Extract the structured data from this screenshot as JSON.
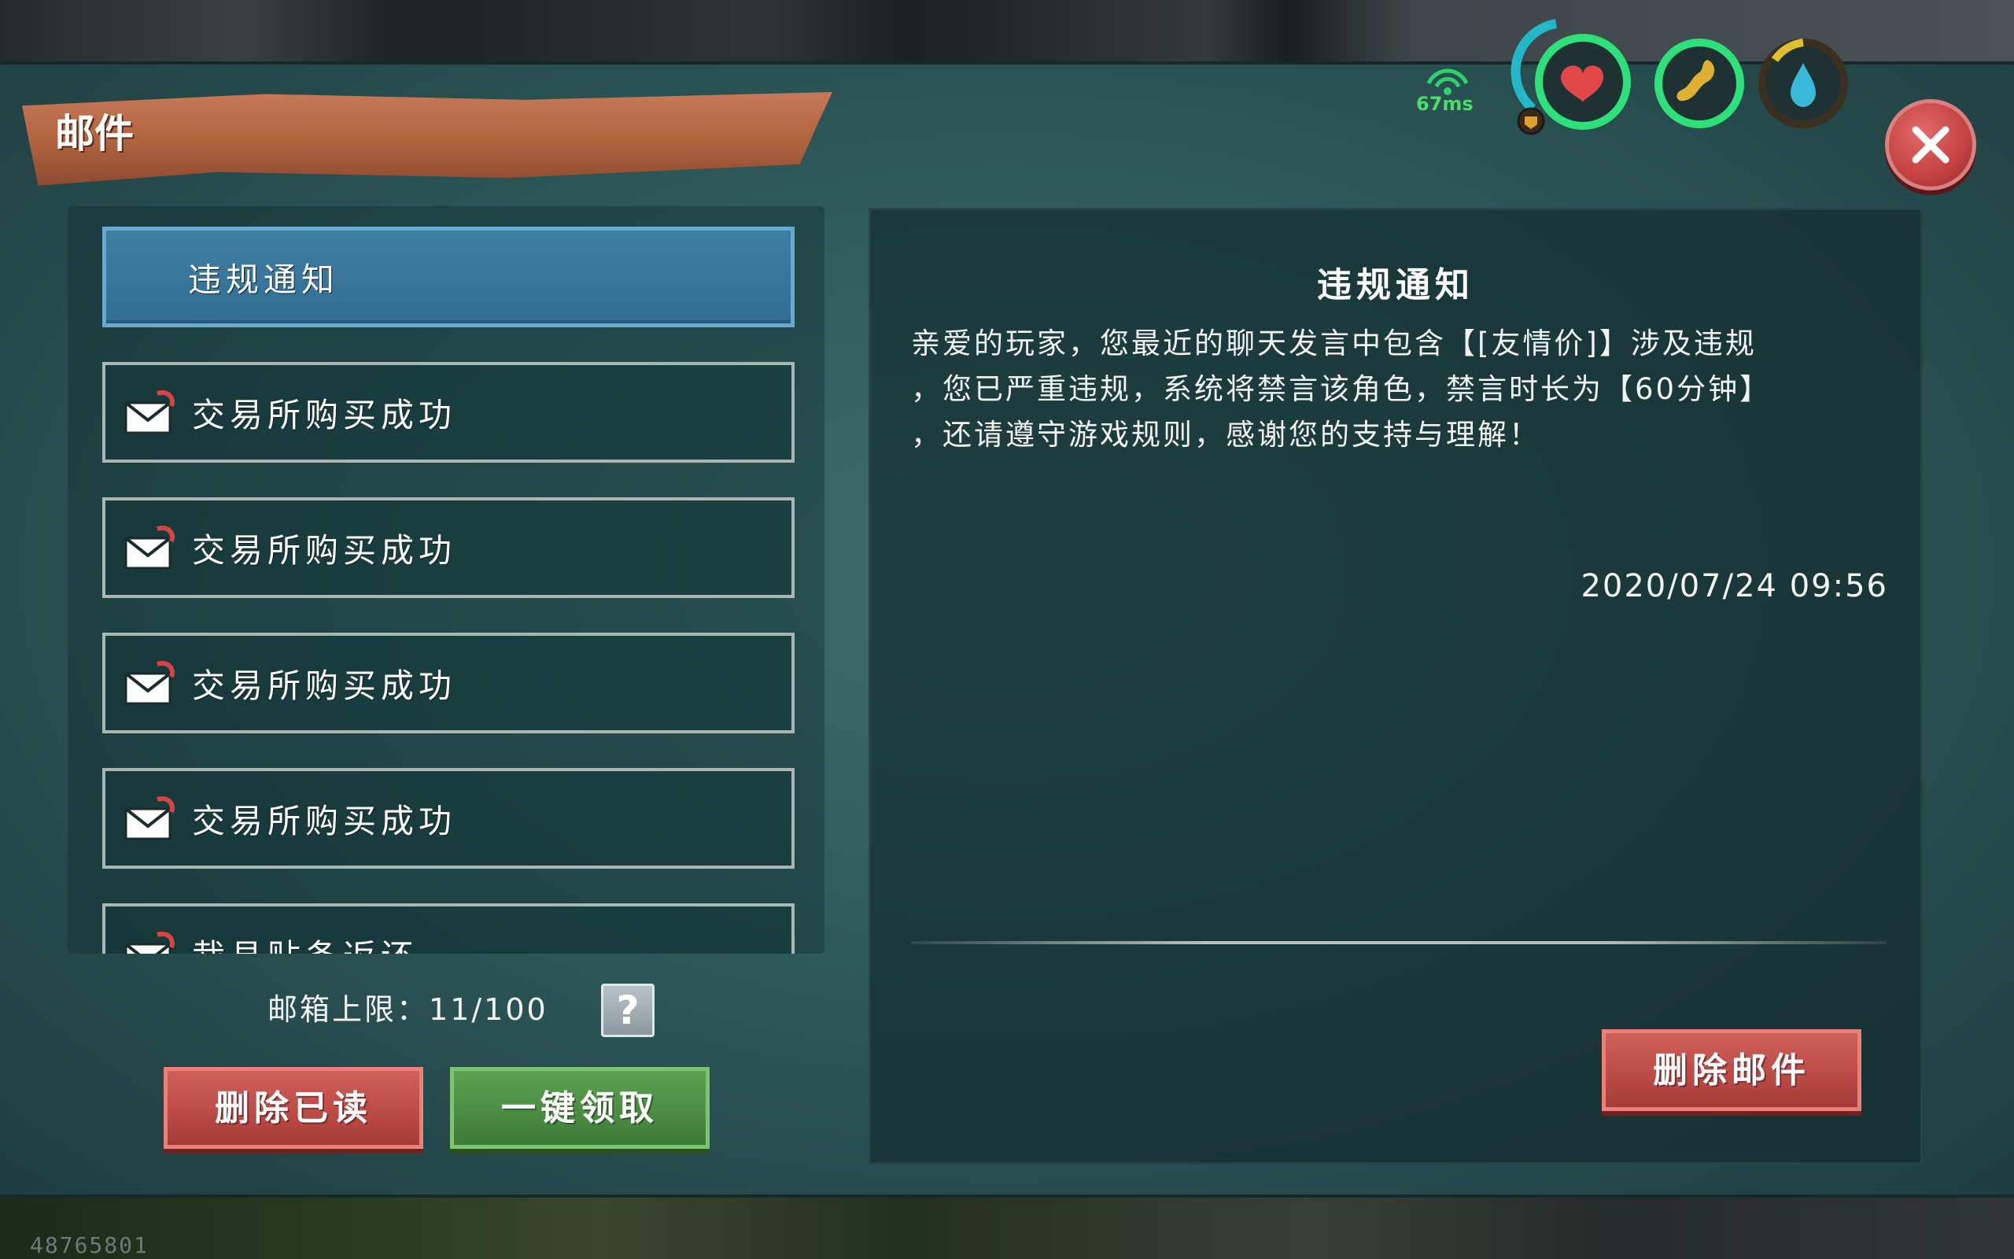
{
  "window": {
    "title": "邮件"
  },
  "mail_list": [
    {
      "label": "违规通知",
      "selected": true,
      "has_icon": false
    },
    {
      "label": "交易所购买成功",
      "selected": false,
      "has_icon": true
    },
    {
      "label": "交易所购买成功",
      "selected": false,
      "has_icon": true
    },
    {
      "label": "交易所购买成功",
      "selected": false,
      "has_icon": true
    },
    {
      "label": "交易所购买成功",
      "selected": false,
      "has_icon": true
    },
    {
      "label": "裁县贴条返还",
      "selected": false,
      "has_icon": true
    }
  ],
  "capacity": {
    "label": "邮箱上限：",
    "value": "11/100",
    "help_icon": "?"
  },
  "buttons": {
    "delete_read": "删除已读",
    "collect_all": "一键领取",
    "delete_mail": "删除邮件"
  },
  "detail": {
    "title": "违规通知",
    "body": "亲爱的玩家，您最近的聊天发言中包含【[友情价]】涉及违规\n，您已严重违规，系统将禁言该角色，禁言时长为【60分钟】\n，还请遵守游戏规则，感谢您的支持与理解！",
    "date": "2020/07/24 09:56"
  },
  "hud": {
    "ping": "67ms",
    "icons": [
      "signal-icon",
      "heart-icon",
      "stomach-icon",
      "water-drop-icon"
    ],
    "colors": {
      "health": "#e04848",
      "food": "#e0b030",
      "water": "#3ab8d8",
      "ring": "#2ee07a"
    }
  },
  "footer": {
    "uid": "48765801"
  }
}
